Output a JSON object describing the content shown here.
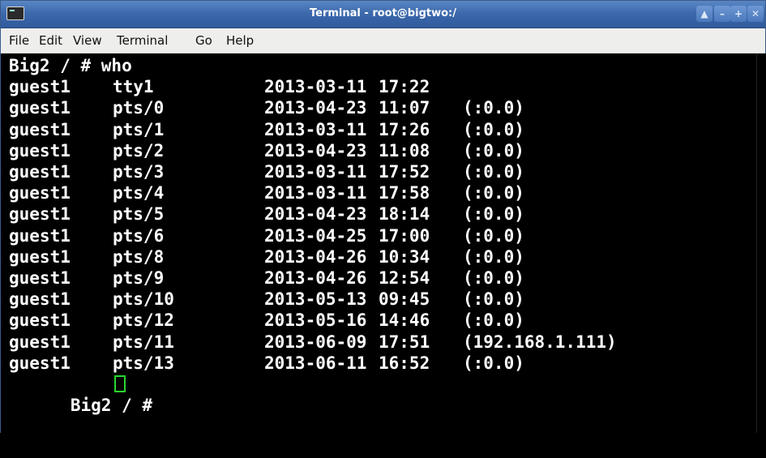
{
  "window": {
    "title": "Terminal - root@bigtwo:/"
  },
  "menubar": {
    "items": [
      "File",
      "Edit",
      "View",
      "Terminal",
      "Go",
      "Help"
    ]
  },
  "terminal": {
    "prompt_command": "Big2 / # who",
    "prompt": "Big2 / #",
    "rows": [
      {
        "user": "guest1",
        "tty": "tty1",
        "date": "2013-03-11",
        "time": "17:22",
        "host": ""
      },
      {
        "user": "guest1",
        "tty": "pts/0",
        "date": "2013-04-23",
        "time": "11:07",
        "host": "(:0.0)"
      },
      {
        "user": "guest1",
        "tty": "pts/1",
        "date": "2013-03-11",
        "time": "17:26",
        "host": "(:0.0)"
      },
      {
        "user": "guest1",
        "tty": "pts/2",
        "date": "2013-04-23",
        "time": "11:08",
        "host": "(:0.0)"
      },
      {
        "user": "guest1",
        "tty": "pts/3",
        "date": "2013-03-11",
        "time": "17:52",
        "host": "(:0.0)"
      },
      {
        "user": "guest1",
        "tty": "pts/4",
        "date": "2013-03-11",
        "time": "17:58",
        "host": "(:0.0)"
      },
      {
        "user": "guest1",
        "tty": "pts/5",
        "date": "2013-04-23",
        "time": "18:14",
        "host": "(:0.0)"
      },
      {
        "user": "guest1",
        "tty": "pts/6",
        "date": "2013-04-25",
        "time": "17:00",
        "host": "(:0.0)"
      },
      {
        "user": "guest1",
        "tty": "pts/8",
        "date": "2013-04-26",
        "time": "10:34",
        "host": "(:0.0)"
      },
      {
        "user": "guest1",
        "tty": "pts/9",
        "date": "2013-04-26",
        "time": "12:54",
        "host": "(:0.0)"
      },
      {
        "user": "guest1",
        "tty": "pts/10",
        "date": "2013-05-13",
        "time": "09:45",
        "host": "(:0.0)"
      },
      {
        "user": "guest1",
        "tty": "pts/12",
        "date": "2013-05-16",
        "time": "14:46",
        "host": "(:0.0)"
      },
      {
        "user": "guest1",
        "tty": "pts/11",
        "date": "2013-06-09",
        "time": "17:51",
        "host": "(192.168.1.111)"
      },
      {
        "user": "guest1",
        "tty": "pts/13",
        "date": "2013-06-11",
        "time": "16:52",
        "host": "(:0.0)"
      }
    ],
    "cursor_color": "#2bd52b"
  }
}
